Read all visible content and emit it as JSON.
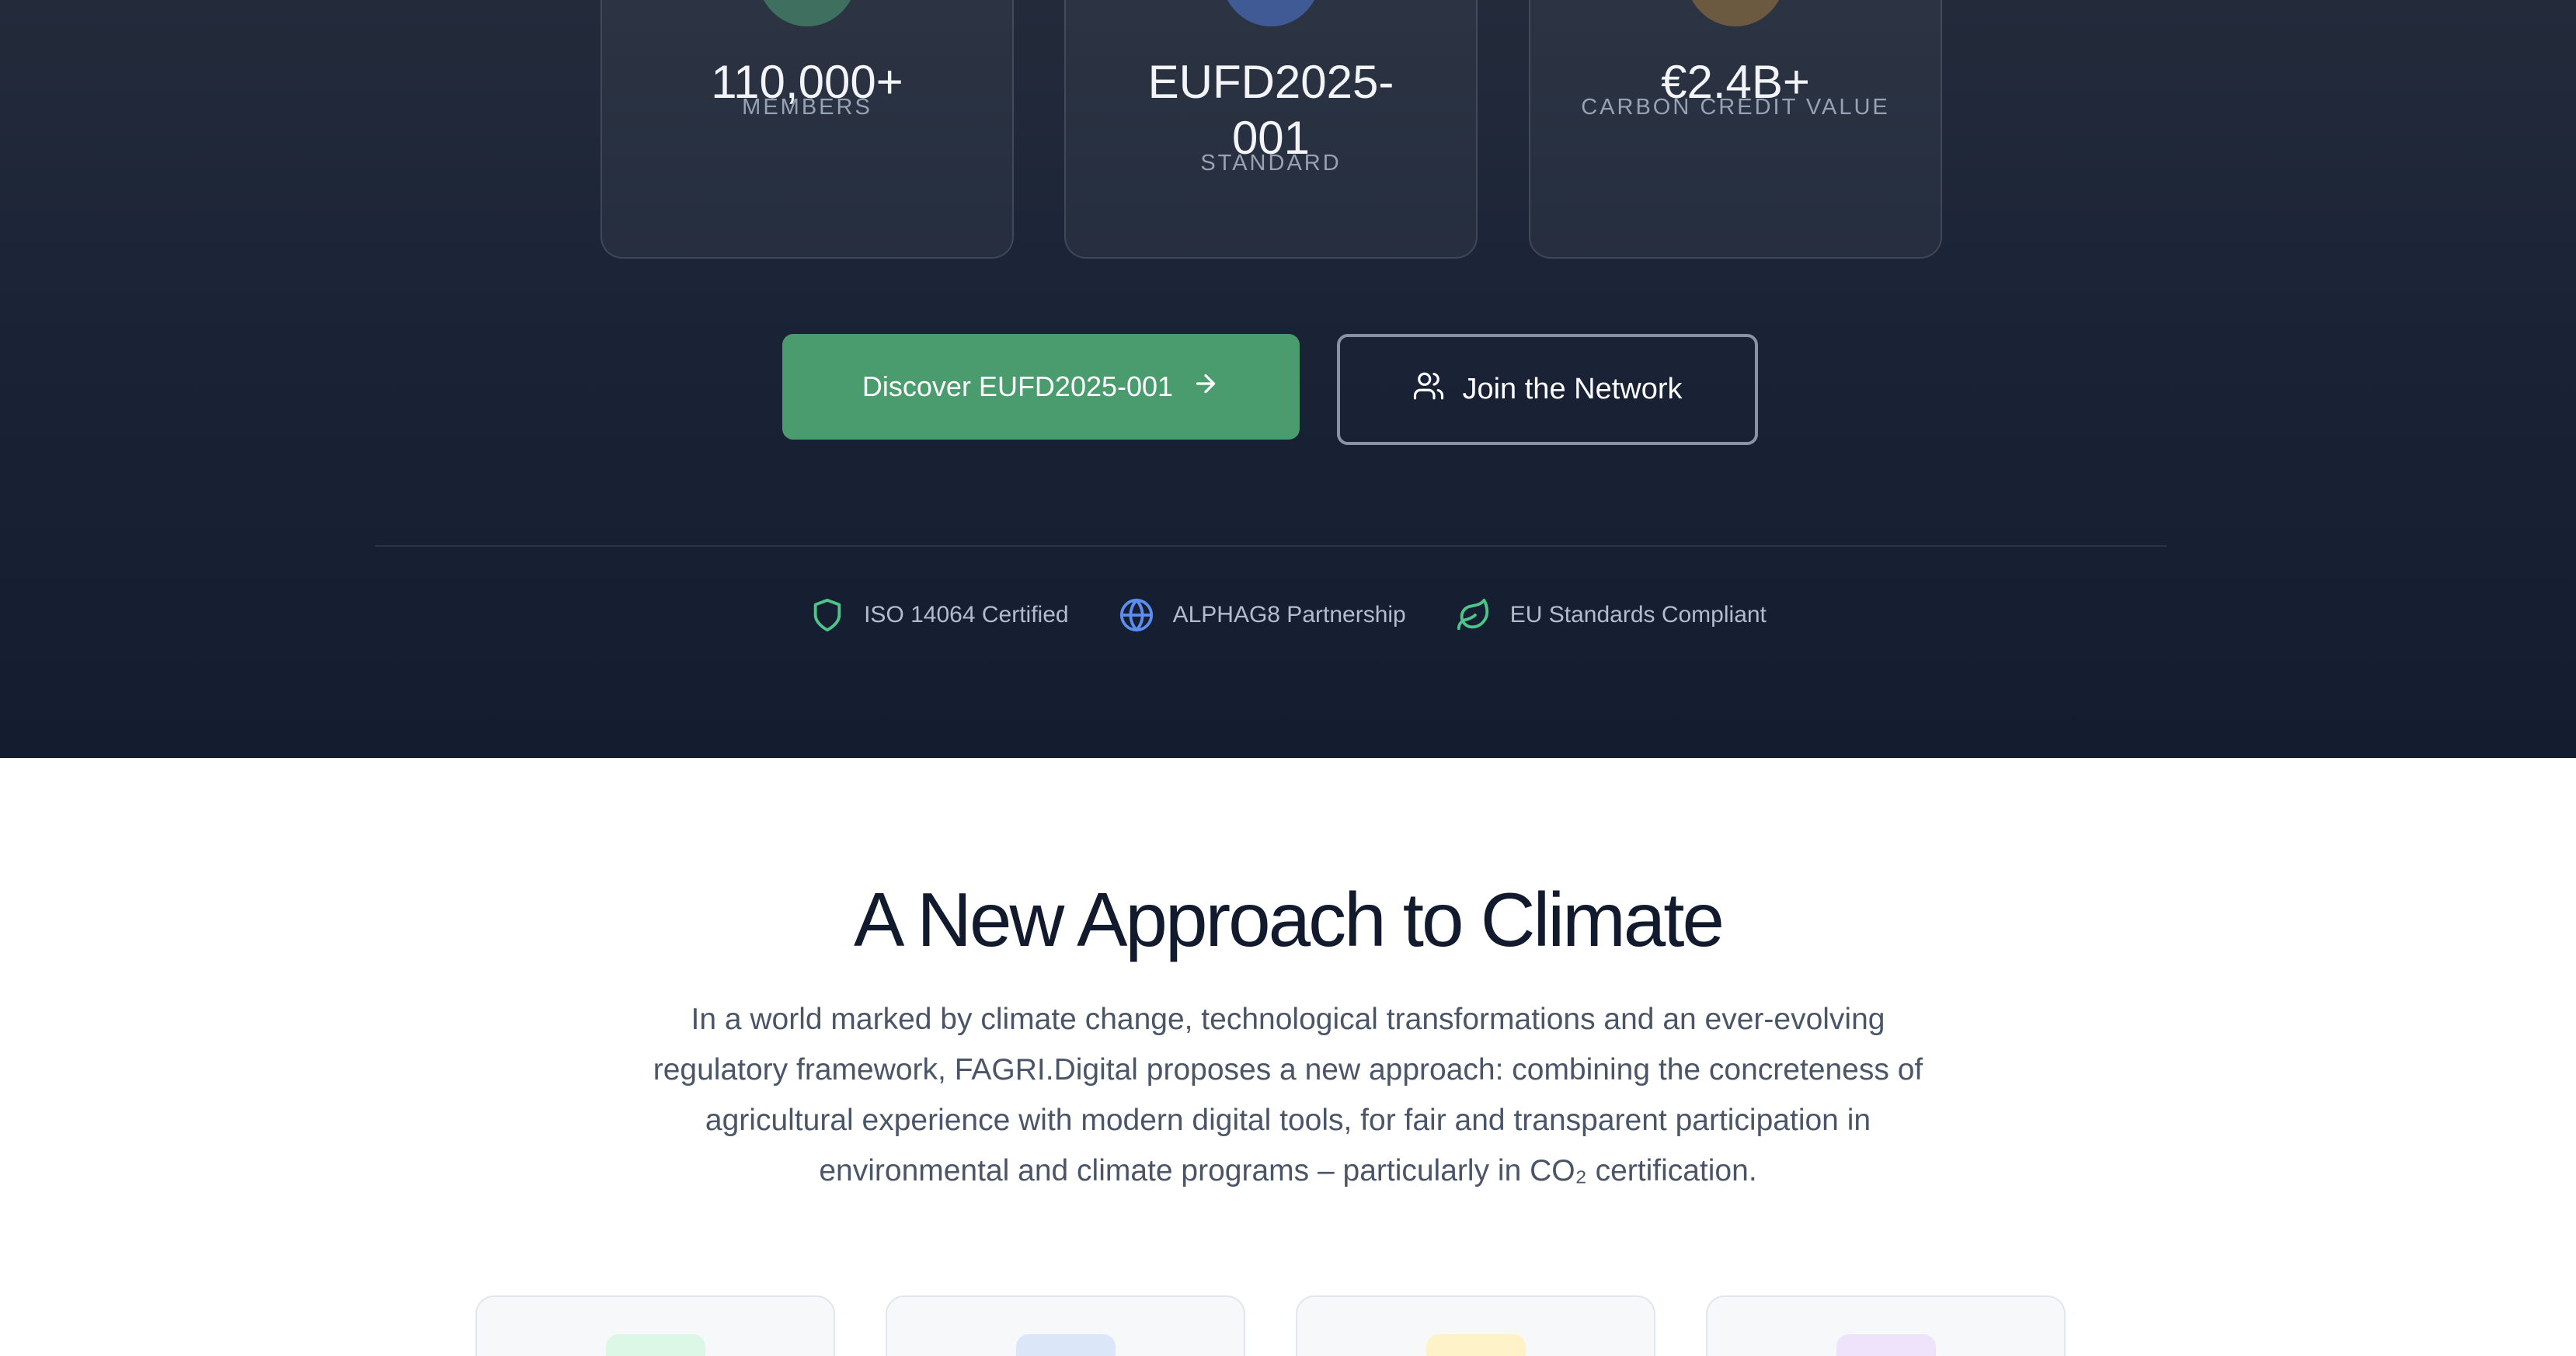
{
  "hero": {
    "stats": [
      {
        "value": "110,000+",
        "label": "MEMBERS",
        "accent": "#3f6f5f"
      },
      {
        "value": "EUFD2025-001",
        "label": "STANDARD",
        "accent": "#3f5a95"
      },
      {
        "value": "€2.4B+",
        "label": "CARBON CREDIT VALUE",
        "accent": "#6b5a40"
      }
    ],
    "primary_button": {
      "label": "Discover EUFD2025-001",
      "icon": "arrow-right-icon",
      "color": "#4a9b6e"
    },
    "secondary_button": {
      "label": "Join the Network",
      "icon": "users-icon"
    },
    "badges": [
      {
        "label": "ISO 14064 Certified",
        "icon": "shield-icon",
        "color": "#4fc48a"
      },
      {
        "label": "ALPHAG8 Partnership",
        "icon": "globe-icon",
        "color": "#5b8ef0"
      },
      {
        "label": "EU Standards Compliant",
        "icon": "leaf-icon",
        "color": "#4fc48a"
      }
    ]
  },
  "approach": {
    "title": "A New Approach to Climate",
    "body": "In a world marked by climate change, technological transformations and an ever-evolving regulatory framework, FAGRI.Digital proposes a new approach: combining the concreteness of agricultural experience with modern digital tools, for fair and transparent participation in environmental and climate programs – particularly in CO₂ certification."
  },
  "feature_cards": [
    {
      "chip_color": "#dcf7e6"
    },
    {
      "chip_color": "#dce6f9"
    },
    {
      "chip_color": "#fdf2c8"
    },
    {
      "chip_color": "#efe3fb"
    }
  ]
}
